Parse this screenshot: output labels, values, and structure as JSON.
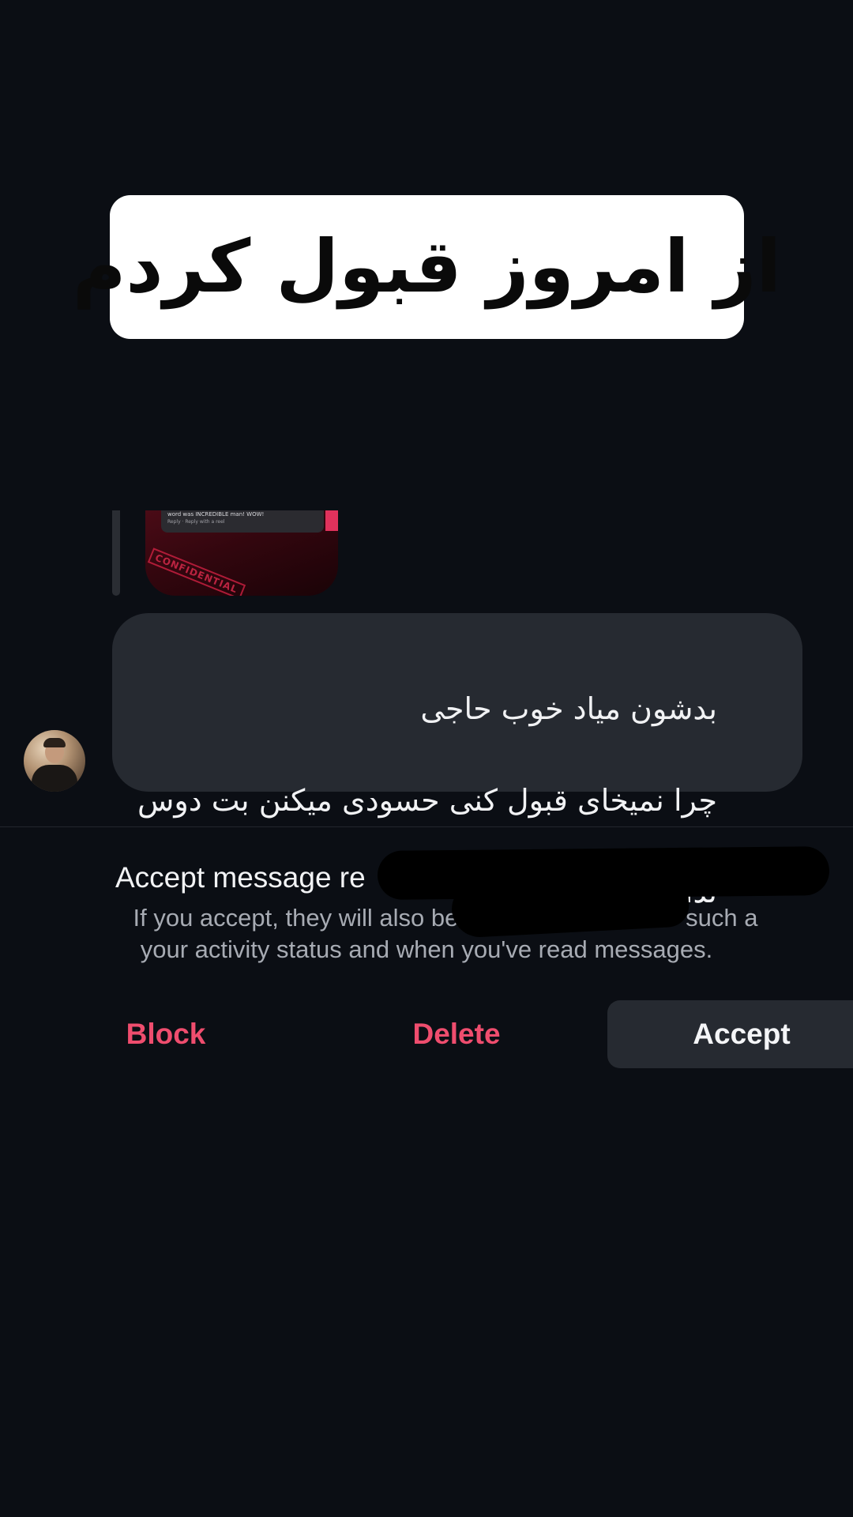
{
  "caption": {
    "text": "از امروز قبول کردم"
  },
  "shared_item": {
    "notice_line": "word was INCREDIBLE man! WOW!",
    "notice_actions": "Reply · Reply with a reel",
    "stamp_text": "CONFIDENTIAL"
  },
  "message": {
    "lines": [
      "بدشون میاد خوب حاجی",
      "چرا نمیخای قبول کنی حسودی میکنن بت دوس",
      "ندارن شناخته بشی"
    ]
  },
  "request": {
    "title": "Accept message re",
    "description_line1": "If you accept, they will also be ab             you and see info such a",
    "description_line2": "your activity status and when you've read messages."
  },
  "actions": {
    "block": "Block",
    "delete": "Delete",
    "accept": "Accept"
  },
  "colors": {
    "background": "#0b0e14",
    "bubble": "#262a31",
    "destructive": "#ef4d6e",
    "secondary_text": "#a7abb3"
  },
  "icons": {
    "avatar": "sender-avatar"
  }
}
